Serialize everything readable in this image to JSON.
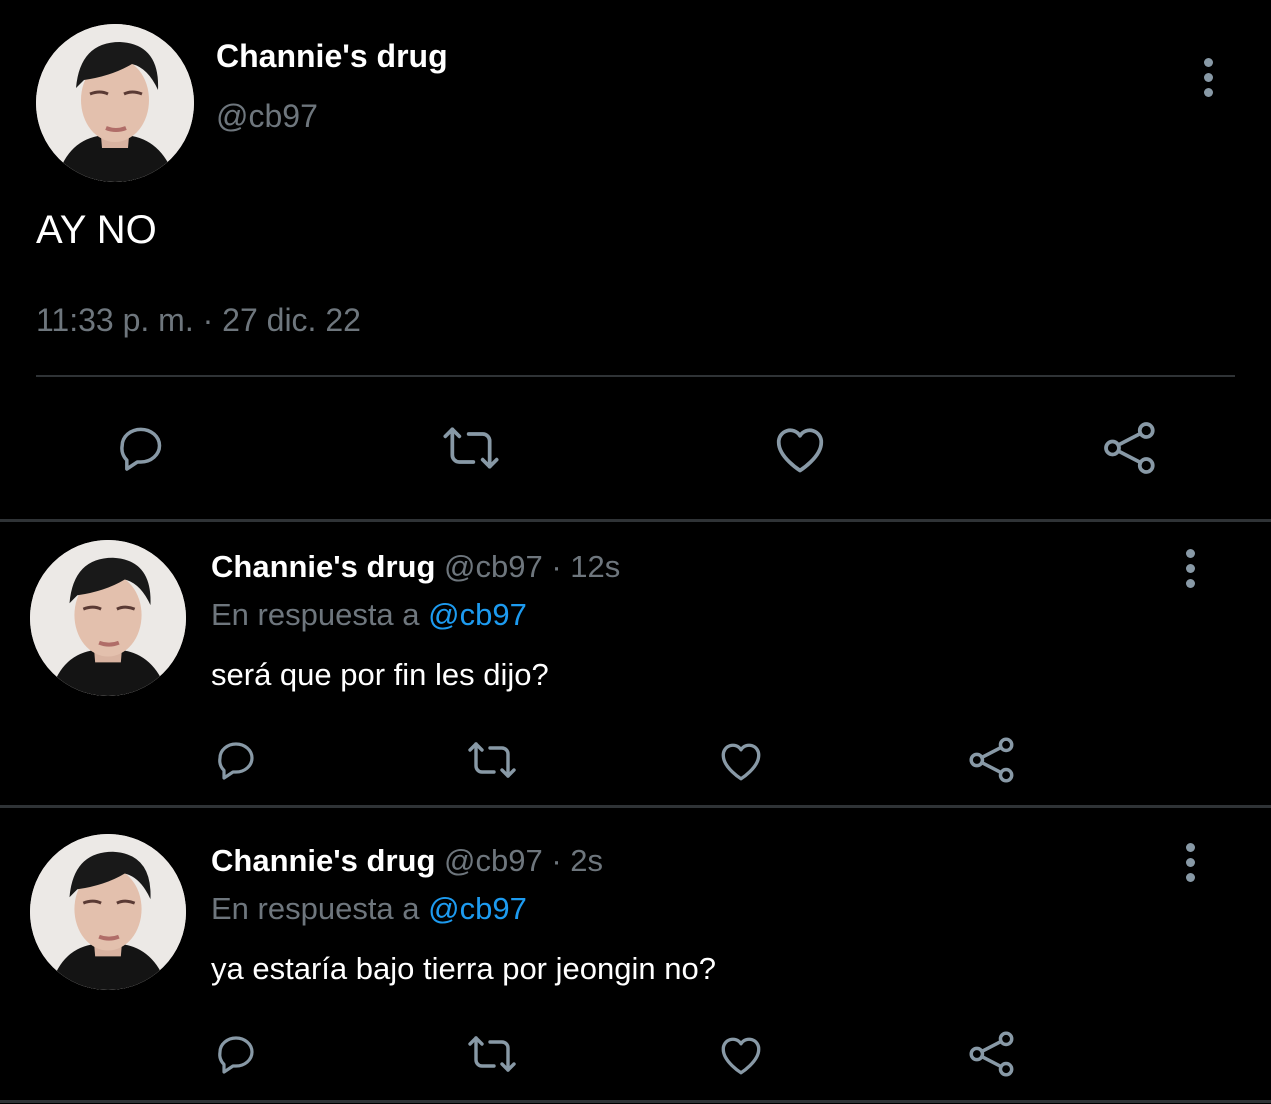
{
  "main_tweet": {
    "author_name": "Channie's drug",
    "author_handle": "@cb97",
    "text": "AY NO",
    "timestamp": "11:33 p. m. · 27 dic. 22"
  },
  "replies": [
    {
      "author_name": "Channie's drug",
      "author_handle": "@cb97",
      "separator": "·",
      "age": "12s",
      "reply_prefix": "En respuesta a",
      "reply_to": "@cb97",
      "text": "será que por fin les dijo?"
    },
    {
      "author_name": "Channie's drug",
      "author_handle": "@cb97",
      "separator": "·",
      "age": "2s",
      "reply_prefix": "En respuesta a",
      "reply_to": "@cb97",
      "text": "ya estaría bajo tierra por jeongin no?"
    }
  ],
  "icons": {
    "reply": "comment-bubble-icon",
    "retweet": "retweet-icon",
    "like": "heart-icon",
    "share": "share-icon",
    "more": "more-vertical-icon"
  },
  "colors": {
    "background": "#000000",
    "primary_text": "#ffffff",
    "secondary_text": "#6e767d",
    "link": "#1d9bf0",
    "icon": "#8899a6",
    "divider": "#2f3336"
  }
}
